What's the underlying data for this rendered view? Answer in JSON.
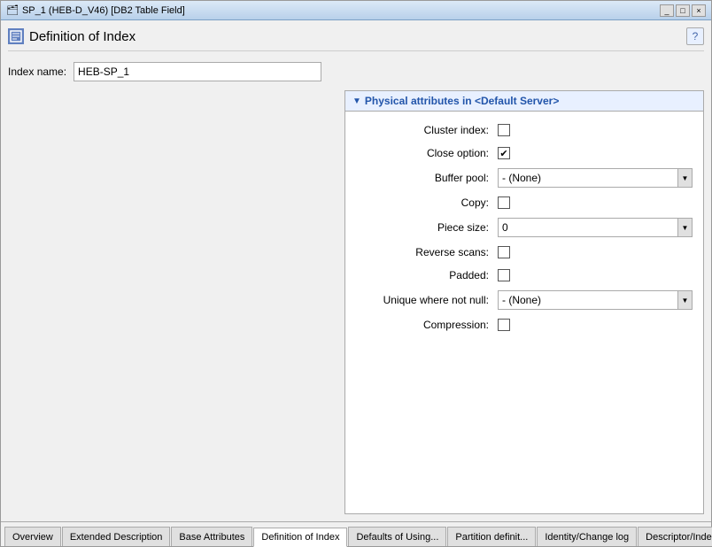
{
  "window": {
    "title": "SP_1 (HEB-D_V46) [DB2 Table Field]",
    "close_label": "×",
    "minimize_label": "_",
    "maximize_label": "□"
  },
  "page": {
    "title": "Definition of Index",
    "help_label": "?"
  },
  "index_name": {
    "label": "Index name:",
    "value": "HEB-SP_1"
  },
  "physical_attributes": {
    "header": "Physical attributes in <Default Server>",
    "properties": [
      {
        "label": "Cluster index:",
        "type": "checkbox",
        "checked": false
      },
      {
        "label": "Close option:",
        "type": "checkbox",
        "checked": true
      },
      {
        "label": "Buffer pool:",
        "type": "dropdown",
        "value": "- (None)"
      },
      {
        "label": "Copy:",
        "type": "checkbox",
        "checked": false
      },
      {
        "label": "Piece size:",
        "type": "dropdown",
        "value": "0"
      },
      {
        "label": "Reverse scans:",
        "type": "checkbox",
        "checked": false
      },
      {
        "label": "Padded:",
        "type": "checkbox",
        "checked": false
      },
      {
        "label": "Unique where not null:",
        "type": "dropdown",
        "value": "- (None)"
      },
      {
        "label": "Compression:",
        "type": "checkbox",
        "checked": false
      }
    ]
  },
  "tabs": [
    {
      "id": "overview",
      "label": "Overview",
      "active": false
    },
    {
      "id": "extended-description",
      "label": "Extended Description",
      "active": false
    },
    {
      "id": "base-attributes",
      "label": "Base Attributes",
      "active": false
    },
    {
      "id": "definition-of-index",
      "label": "Definition of Index",
      "active": true
    },
    {
      "id": "defaults-of-using",
      "label": "Defaults of Using...",
      "active": false
    },
    {
      "id": "partition-definit",
      "label": "Partition definit...",
      "active": false
    },
    {
      "id": "identity-change-log",
      "label": "Identity/Change log",
      "active": false
    },
    {
      "id": "descriptor-index",
      "label": "Descriptor/Index ...",
      "active": false
    }
  ],
  "tab_more_label": "»"
}
